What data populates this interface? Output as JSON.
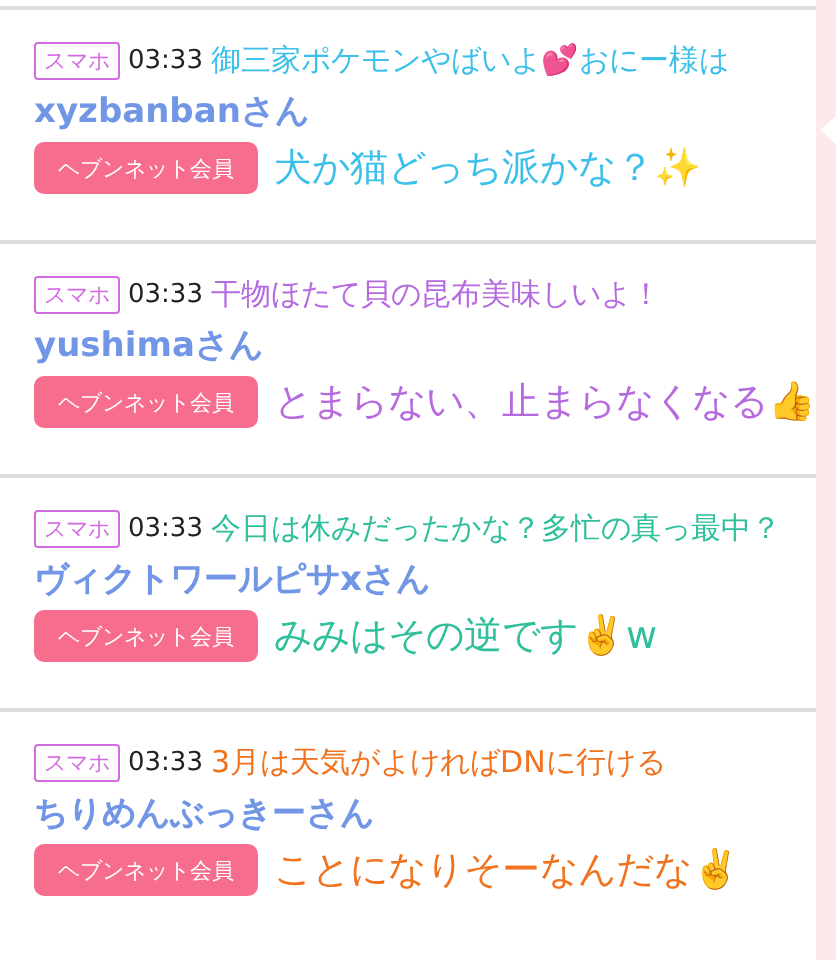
{
  "posts": [
    {
      "device": "スマホ",
      "time": "03:33",
      "name": "xyzbanbanさん",
      "badge": "ヘブンネット会員",
      "overlay": {
        "color": "#3cbfe9",
        "lines": [
          "御三家ポケモンやばいよ💕おにー様は",
          "犬か猫どっち派かな？✨"
        ]
      }
    },
    {
      "device": "スマホ",
      "time": "03:33",
      "name": "yushimaさん",
      "badge": "ヘブンネット会員",
      "overlay": {
        "color": "#b56ae0",
        "lines": [
          "干物ほたて貝の昆布美味しいよ！",
          "とまらない、止まらなくなる👍"
        ]
      }
    },
    {
      "device": "スマホ",
      "time": "03:33",
      "name": "ヴィクトワールピサxさん",
      "badge": "ヘブンネット会員",
      "overlay": {
        "color": "#2fbf9c",
        "lines": [
          "今日は休みだったかな？多忙の真っ最中？",
          "みみはその逆です✌️w"
        ]
      }
    },
    {
      "device": "スマホ",
      "time": "03:33",
      "name": "ちりめんぶっきーさん",
      "badge": "ヘブンネット会員",
      "overlay": {
        "color": "#f0731f",
        "lines": [
          "3月は天気がよければDNに行ける",
          "ことになりそーなんだな✌️"
        ]
      }
    }
  ]
}
